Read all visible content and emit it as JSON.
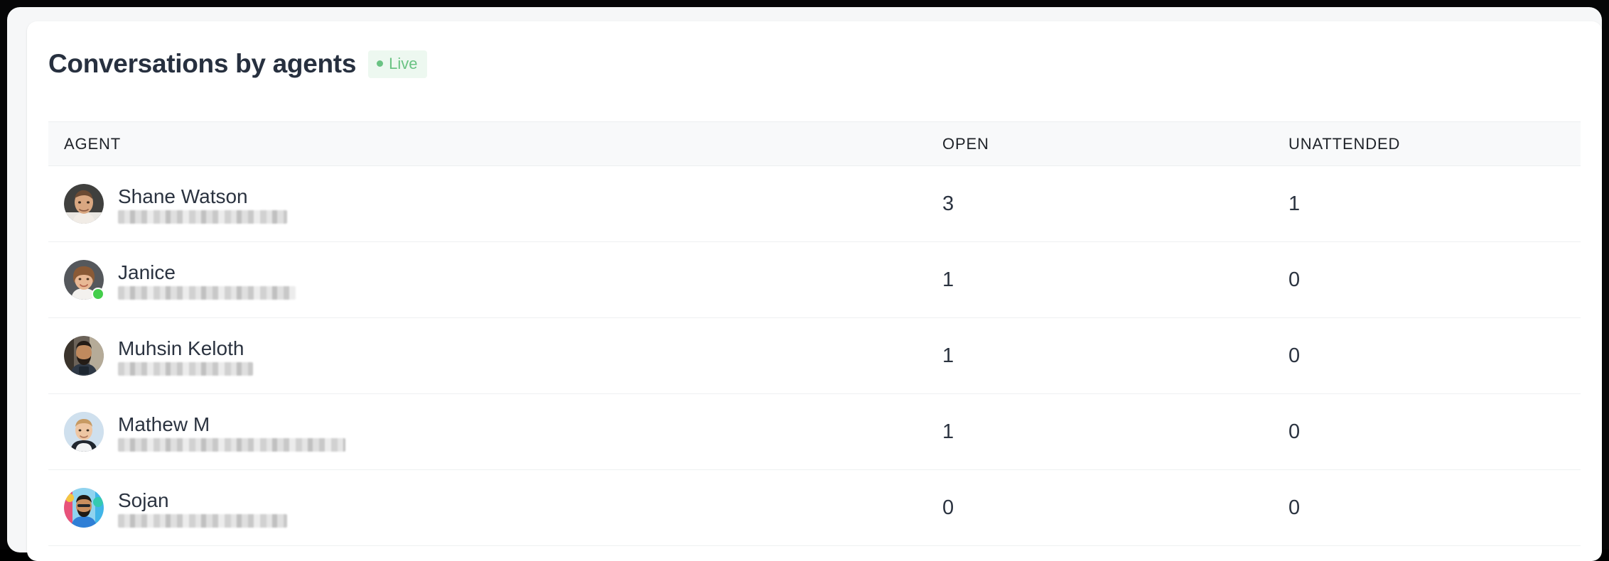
{
  "card": {
    "title": "Conversations by agents",
    "live_badge": {
      "label": "Live",
      "dot_color": "#6ac383",
      "text_color": "#6ac383",
      "background": "#edf8f0"
    }
  },
  "table": {
    "columns": [
      {
        "key": "agent",
        "label": "AGENT"
      },
      {
        "key": "open",
        "label": "OPEN"
      },
      {
        "key": "unattended",
        "label": "UNATTENDED"
      }
    ],
    "rows": [
      {
        "name": "Shane Watson",
        "email": "",
        "email_redacted": true,
        "online": false,
        "open": "3",
        "unattended": "1"
      },
      {
        "name": "Janice",
        "email": "",
        "email_redacted": true,
        "online": true,
        "open": "1",
        "unattended": "0"
      },
      {
        "name": "Muhsin Keloth",
        "email": "",
        "email_redacted": true,
        "online": false,
        "open": "1",
        "unattended": "0"
      },
      {
        "name": "Mathew M",
        "email": "",
        "email_redacted": true,
        "online": false,
        "open": "1",
        "unattended": "0"
      },
      {
        "name": "Sojan",
        "email": "",
        "email_redacted": true,
        "online": false,
        "open": "0",
        "unattended": "0"
      }
    ]
  }
}
